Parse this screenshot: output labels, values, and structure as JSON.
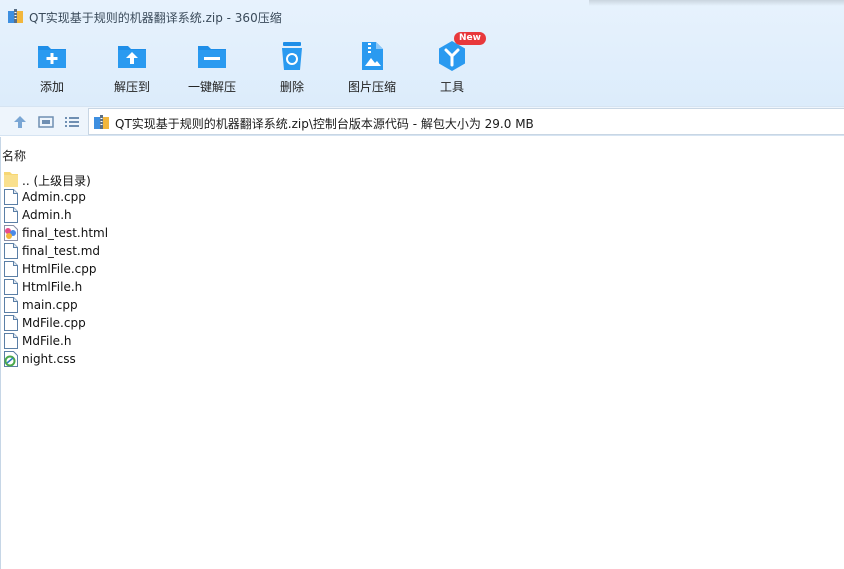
{
  "window": {
    "title": "QT实现基于规则的机器翻译系统.zip - 360压缩"
  },
  "toolbar": {
    "buttons": [
      {
        "label": "添加",
        "icon": "add-folder-icon"
      },
      {
        "label": "解压到",
        "icon": "extract-to-icon"
      },
      {
        "label": "一键解压",
        "icon": "one-click-extract-icon"
      },
      {
        "label": "删除",
        "icon": "recycle-bin-icon"
      },
      {
        "label": "图片压缩",
        "icon": "image-compress-icon"
      },
      {
        "label": "工具",
        "icon": "tools-icon",
        "badge": "New"
      }
    ]
  },
  "navbar": {
    "path": "QT实现基于规则的机器翻译系统.zip\\控制台版本源代码 - 解包大小为 29.0 MB"
  },
  "filelist": {
    "column_header": "名称",
    "items": [
      {
        "name": ".. (上级目录)",
        "icon": "parent-folder-icon"
      },
      {
        "name": "Admin.cpp",
        "icon": "file-icon"
      },
      {
        "name": "Admin.h",
        "icon": "file-icon"
      },
      {
        "name": "final_test.html",
        "icon": "html-file-icon"
      },
      {
        "name": "final_test.md",
        "icon": "file-icon"
      },
      {
        "name": "HtmlFile.cpp",
        "icon": "file-icon"
      },
      {
        "name": "HtmlFile.h",
        "icon": "file-icon"
      },
      {
        "name": "main.cpp",
        "icon": "file-icon"
      },
      {
        "name": "MdFile.cpp",
        "icon": "file-icon"
      },
      {
        "name": "MdFile.h",
        "icon": "file-icon"
      },
      {
        "name": "night.css",
        "icon": "css-file-icon"
      }
    ]
  },
  "colors": {
    "accent": "#1e8ee8",
    "toolbar_bg": "#dcecfb",
    "badge": "#e8383b"
  }
}
